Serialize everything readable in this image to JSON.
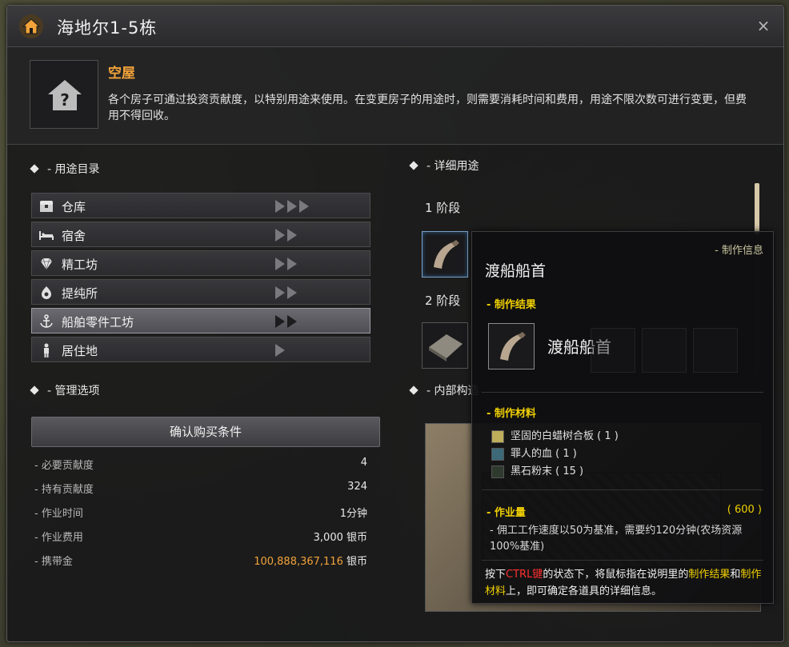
{
  "window": {
    "title": "海地尔1-5栋",
    "close_label": "×"
  },
  "house": {
    "status": "空屋",
    "description": "各个房子可通过投资贡献度，以特别用途来使用。在变更房子的用途时，则需要消耗时间和费用，用途不限次数可进行变更，但费用不得回收。"
  },
  "left": {
    "uses_title": "- 用途目录",
    "uses": [
      {
        "label": "仓库",
        "icon": "chest-icon",
        "arrows": 3
      },
      {
        "label": "宿舍",
        "icon": "bed-icon",
        "arrows": 2
      },
      {
        "label": "精工坊",
        "icon": "diamond-icon",
        "arrows": 2
      },
      {
        "label": "提纯所",
        "icon": "refine-icon",
        "arrows": 2
      },
      {
        "label": "船舶零件工坊",
        "icon": "anchor-icon",
        "arrows": 2,
        "selected": true
      },
      {
        "label": "居住地",
        "icon": "person-icon",
        "arrows": 1
      }
    ],
    "manage_title": "- 管理选项",
    "confirm_button": "确认购买条件",
    "stats": [
      {
        "key": "- 必要贡献度",
        "value": "4"
      },
      {
        "key": "- 持有贡献度",
        "value": "324"
      },
      {
        "key": "- 作业时间",
        "value": "1分钟"
      },
      {
        "key": "- 作业费用",
        "value": "3,000 银币"
      },
      {
        "key": "- 携带金",
        "value_gold": "100,888,367,116",
        "value_unit": " 银币"
      }
    ]
  },
  "right": {
    "detail_title": "- 详细用途",
    "stage1": "1 阶段",
    "stage2": "2 阶段",
    "interior_title": "- 内部构造"
  },
  "tooltip": {
    "category": "- 制作信息",
    "name": "渡船船首",
    "result_title": "- 制作结果",
    "result_name": "渡船船首",
    "materials_title": "- 制作材料",
    "materials": [
      "坚固的白蜡树合板 ( 1 )",
      "罪人的血 ( 1 )",
      "黑石粉末 ( 15 )"
    ],
    "work_title": "- 作业量",
    "work_value": "( 600 )",
    "work_desc": "- 佣工工作速度以50为基准，需要约120分钟(农场资源100%基准)",
    "hint_pre": "按下",
    "hint_key": "CTRL键",
    "hint_mid": "的状态下，将鼠标指在说明里的",
    "hint_result": "制作结果",
    "hint_and": "和",
    "hint_mat": "制作材料",
    "hint_end": "上，即可确定各道具的详细信息。"
  },
  "colors": {
    "accent_orange": "#f2a33a",
    "accent_yellow": "#f0d000",
    "accent_red": "#ff3030"
  }
}
